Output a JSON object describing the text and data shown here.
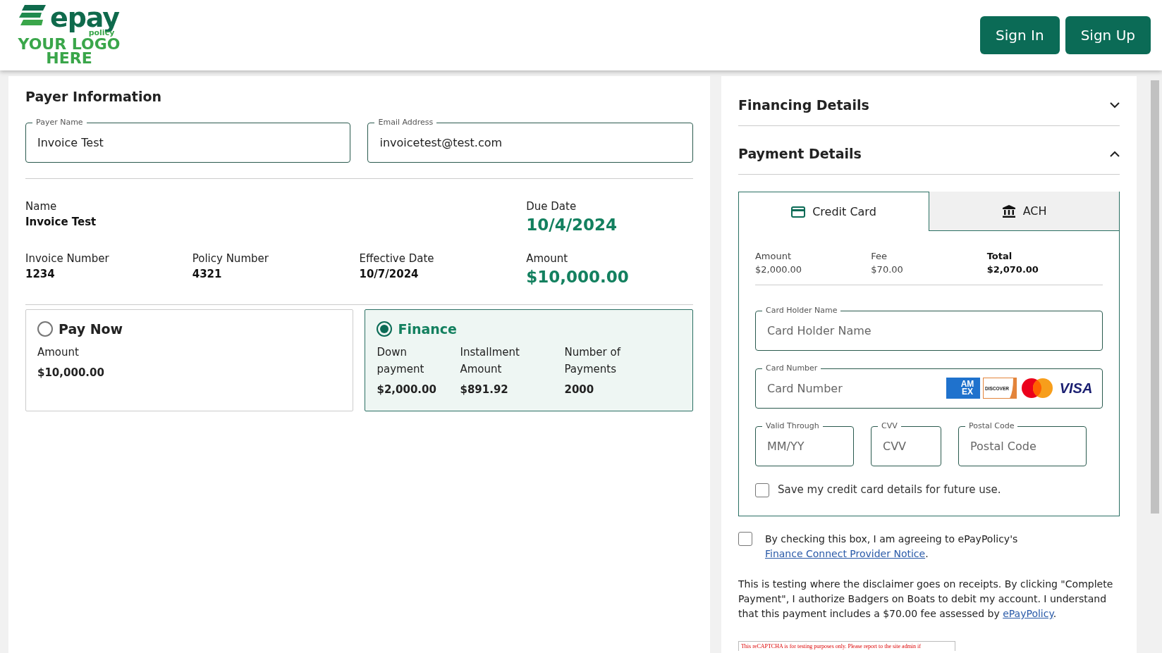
{
  "header": {
    "logo": {
      "brand": "epay",
      "sub": "policy",
      "placeholder": "YOUR LOGO HERE"
    },
    "buttons": [
      {
        "label": "Sign In"
      },
      {
        "label": "Sign Up"
      }
    ]
  },
  "payer_information": {
    "title": "Payer Information",
    "fields": [
      {
        "label": "Payer Name",
        "value": "Invoice Test"
      },
      {
        "label": "Email Address",
        "value": "invoicetest@test.com"
      }
    ],
    "summary_rows": [
      [
        {
          "label": "Name",
          "value": "Invoice Test",
          "kind": "plain"
        },
        {
          "label": "Due Date",
          "value": "10/4/2024",
          "kind": "highlight"
        }
      ],
      [
        {
          "label": "Invoice Number",
          "value": "1234",
          "kind": "plain"
        },
        {
          "label": "Policy Number",
          "value": "4321",
          "kind": "plain"
        },
        {
          "label": "Effective Date",
          "value": "10/7/2024",
          "kind": "plain"
        },
        {
          "label": "Amount",
          "value": "$10,000.00",
          "kind": "highlight"
        }
      ]
    ],
    "options": [
      {
        "title": "Pay Now",
        "selected": false,
        "details": [
          {
            "label": "Amount",
            "value": "$10,000.00"
          }
        ]
      },
      {
        "title": "Finance",
        "selected": true,
        "details": [
          {
            "label": "Down payment",
            "value": "$2,000.00"
          },
          {
            "label": "Installment Amount",
            "value": "$891.92"
          },
          {
            "label": "Number of Payments",
            "value": "2000"
          }
        ]
      }
    ]
  },
  "sections": [
    {
      "title": "Financing Details",
      "expanded": false
    },
    {
      "title": "Payment Details",
      "expanded": true
    }
  ],
  "payment_tabs": [
    {
      "label": "Credit Card",
      "kind": "card",
      "selected": true
    },
    {
      "label": "ACH",
      "kind": "bank",
      "selected": false
    }
  ],
  "totals": [
    {
      "label": "Amount",
      "value": "$2,000.00",
      "emphasis": false
    },
    {
      "label": "Fee",
      "value": "$70.00",
      "emphasis": false
    },
    {
      "label": "Total",
      "value": "$2,070.00",
      "emphasis": true
    }
  ],
  "card_fields": [
    {
      "label": "Card Holder Name",
      "placeholder": "Card Holder Name",
      "kind": "full"
    },
    {
      "label": "Card Number",
      "placeholder": "Card Number",
      "kind": "card_number"
    },
    {
      "label": "Valid Through",
      "placeholder": "MM/YY",
      "kind": "third"
    },
    {
      "label": "CVV",
      "placeholder": "CVV",
      "kind": "third"
    },
    {
      "label": "Postal Code",
      "placeholder": "Postal Code",
      "kind": "third"
    }
  ],
  "card_brands": [
    {
      "kind": "amex",
      "text": "AM EX"
    },
    {
      "kind": "discover",
      "text": "DISCOVER"
    },
    {
      "kind": "mastercard"
    },
    {
      "kind": "visa",
      "text": "VISA"
    }
  ],
  "save_card": {
    "label": "Save my credit card details for future use.",
    "checked": false
  },
  "agreement": {
    "checked": false,
    "text": "By checking this box, I am agreeing to ePayPolicy's ",
    "link": "Finance Connect Provider Notice",
    "after": "."
  },
  "disclaimer": {
    "text": "This is testing where the disclaimer goes on receipts. By clicking \"Complete Payment\", I authorize Badgers on Boats to debit my account. I understand that this payment includes a $70.00 fee assessed by ",
    "link": "ePayPolicy",
    "after": "."
  },
  "captcha_notice": "This reCAPTCHA is for testing purposes only. Please report to the site admin if"
}
